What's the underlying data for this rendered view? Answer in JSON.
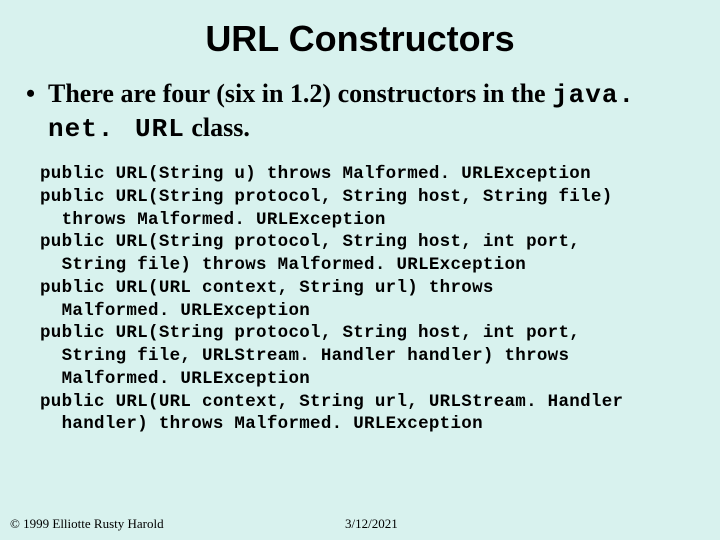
{
  "title": "URL Constructors",
  "bullet": {
    "pre": "There are four (six in 1.2) constructors in the ",
    "code": "java. net. URL",
    "post": " class."
  },
  "code": "public URL(String u) throws Malformed. URLException\npublic URL(String protocol, String host, String file)\n  throws Malformed. URLException\npublic URL(String protocol, String host, int port,\n  String file) throws Malformed. URLException\npublic URL(URL context, String url) throws\n  Malformed. URLException\npublic URL(String protocol, String host, int port,\n  String file, URLStream. Handler handler) throws\n  Malformed. URLException\npublic URL(URL context, String url, URLStream. Handler\n  handler) throws Malformed. URLException",
  "footer": {
    "copyright": "© 1999 Elliotte Rusty Harold",
    "date": "3/12/2021"
  }
}
